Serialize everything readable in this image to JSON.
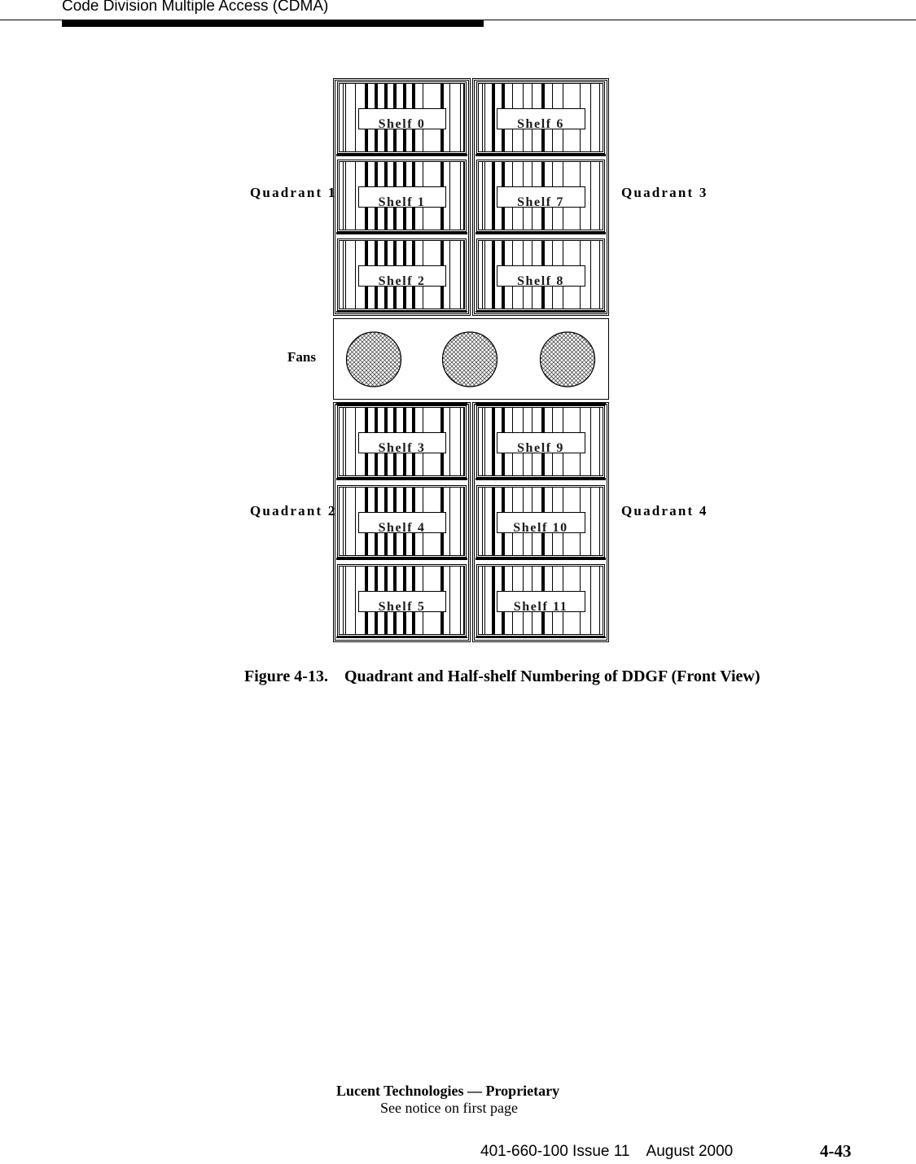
{
  "header": {
    "running_title": "Code Division Multiple Access (CDMA)"
  },
  "figure": {
    "quadrant_labels": {
      "q1": "Quadrant 1",
      "q2": "Quadrant 2",
      "q3": "Quadrant 3",
      "q4": "Quadrant 4"
    },
    "fans_label": "Fans",
    "fan_count": 3,
    "left_column_shelves": [
      "Shelf 0",
      "Shelf 1",
      "Shelf 2",
      "Shelf 3",
      "Shelf 4",
      "Shelf 5"
    ],
    "right_column_shelves": [
      "Shelf 6",
      "Shelf 7",
      "Shelf 8",
      "Shelf 9",
      "Shelf 10",
      "Shelf 11"
    ],
    "caption": "Figure 4-13.    Quadrant and Half-shelf Numbering of DDGF (Front View)"
  },
  "footer": {
    "proprietary": "Lucent Technologies — Proprietary",
    "notice": "See notice on first page",
    "doc_info": "401-660-100 Issue 11    August 2000",
    "page_number": "4-43"
  }
}
